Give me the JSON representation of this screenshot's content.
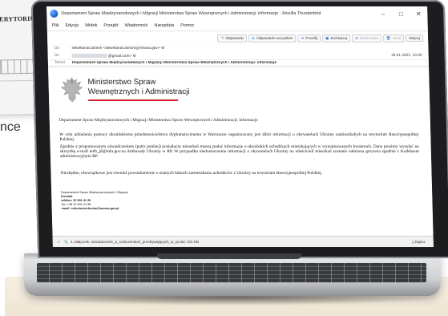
{
  "background": {
    "doc_label": "ERYTORIUM",
    "side_text": "nce"
  },
  "window": {
    "title": "Departament Spraw Międzynarodowych i Migracji Ministerstwa Spraw Wewnętrznych i Administracji: informacje - Mozilla Thunderbird",
    "minimize": "–",
    "maximize": "□",
    "close": "✕"
  },
  "menu": {
    "items": [
      "Plik",
      "Edycja",
      "Widok",
      "Przejdź",
      "Wiadomość",
      "Narzędzia",
      "Pomoc"
    ]
  },
  "actions": {
    "reply": "Odpowiedz",
    "reply_all": "Odpowiedz wszystkim",
    "forward": "Prześlij",
    "archive": "Archiwizuj",
    "junk": "Niechciana",
    "delete": "Usuń",
    "more": "Więcej"
  },
  "message_header": {
    "from_label": "Od",
    "from_value": "sekretariat.dsmim <sekretariat.dsmim@mswia.gov> ⚙",
    "to_label": "Do",
    "to_value": "@gmail.com> ⚙",
    "date": "19.01.2023, 15:06",
    "subject_label": "Temat",
    "subject_value": "Departament Spraw Międzynarodowych i Migracji Ministerstwa Spraw Wewnętrznych i Administracji: informacje"
  },
  "body": {
    "ministry_line1": "Ministerstwo Spraw",
    "ministry_line2": "Wewnętrznych i Administracji",
    "heading": "Departament Spraw Międzynarodowych i Migracji Ministerstwa Spraw Wewnętrznych i Administracji: informacje",
    "paragraph1": "W celu udzielenia pomocy ukraińskiemu przedstawicielstwu dyplomatycznemu w Warszawie organizowany jest zbiór informacji o obywatelach Ukrainy zamieszkałych na terytorium Rzeczypospolitej Polskiej.",
    "paragraph2": "Zgodnie z proponowanym oświadczeniem (patrz poniżej) posiadacze mieszkań muszą podać informacje o ukraińskich uchodźcach mieszkających w wynajmowanych kwaterach. Dane prosimy wysyłać na skrzynkę e-mail emb_pl@mfa.gov.ua Ambasady Ukrainy w RP. W przypadku niedostarczenia informacji o obywatelach Ukrainy na właścicieli mieszkań zostanie nałożona grzywna zgodnie z Kodeksem administracyjnym RP.",
    "paragraph3": "Niezbędne, obowiązkowe jest również powiadomienie o znanych faktach zamieszkania uchodźców z Ukrainy na terytorium Rzeczypospolitej Polskiej.",
    "signature": {
      "dept": "Departament Spraw Międzynarodowych i Migracji",
      "unit": "Kontakt",
      "phone": "telefon: 22 601 41 20",
      "fax": "fax: +48 22 601 41 98",
      "email": "email: sekretariat.dsmim@mswia.gov.pl"
    }
  },
  "attachment": {
    "text": "1 załącznik: oświadczenie_o_rozliczeniach_przebywających_w_rp.doc 131 KB",
    "save": "Zapisz"
  }
}
